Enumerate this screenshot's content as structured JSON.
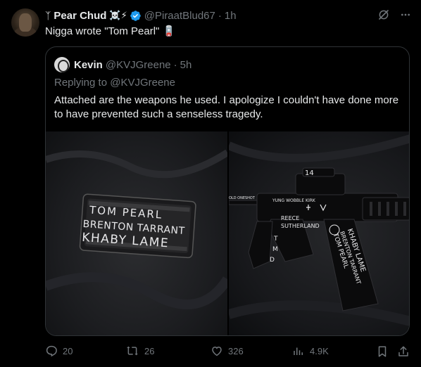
{
  "tweet": {
    "author_prefix": "ᛉ",
    "author_name": "Pear Chud",
    "author_emoji": "☠️⚡",
    "author_handle": "@PiraatBlud67",
    "dot": "·",
    "time": "1h",
    "text": "Nigga wrote \"Tom Pearl\" 🪫"
  },
  "quote": {
    "name": "Kevin",
    "handle": "@KVJGreene",
    "dot": "·",
    "time": "5h",
    "replying_prefix": "Replying to ",
    "replying_handle": "@KVJGreene",
    "text": "Attached are the weapons he used. I apologize I couldn't have done more to have prevented such a senseless tragedy.",
    "image_left_text": [
      "TOM PEARL",
      "BRENTON TARRANT",
      "KHABY LAME"
    ],
    "image_right_text": [
      "14",
      "YUNG WOBBLE KIRK",
      "OLD ONESHOT",
      "REECE",
      "SUTHERLAND",
      "TOM PEARL",
      "BRENTON TARRANT",
      "KHABY LAME",
      "T",
      "M",
      "D"
    ]
  },
  "actions": {
    "replies": "20",
    "reposts": "26",
    "likes": "326",
    "views": "4.9K"
  },
  "colors": {
    "background": "#000000",
    "text": "#e7e9ea",
    "muted": "#71767b",
    "verified": "#1d9bf0",
    "border": "#2f3336"
  },
  "icons": [
    "grok-icon",
    "more-icon",
    "verified-icon",
    "reply-icon",
    "repost-icon",
    "like-icon",
    "views-icon",
    "bookmark-icon",
    "share-icon"
  ]
}
